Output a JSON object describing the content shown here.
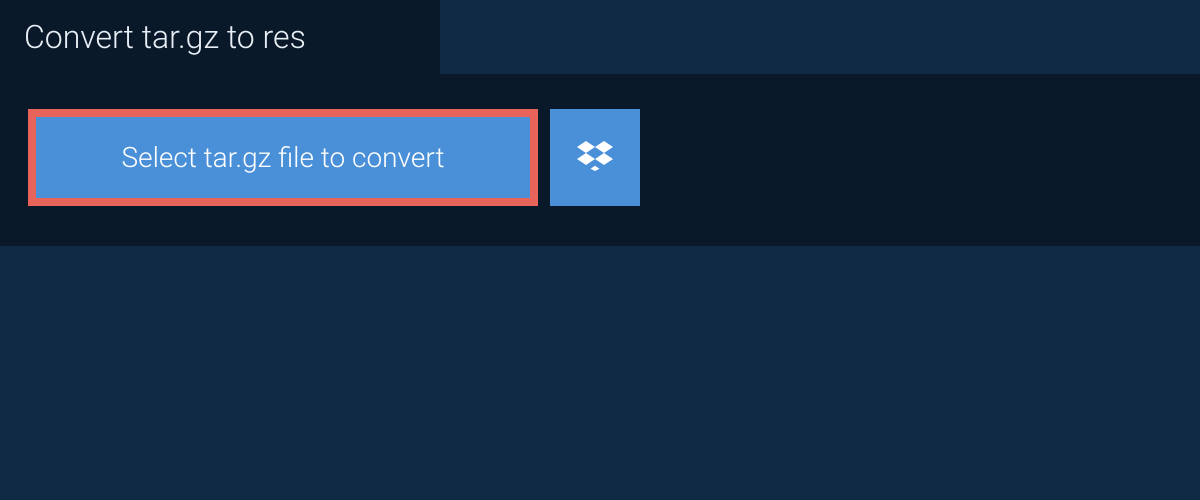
{
  "header": {
    "title": "Convert tar.gz to res"
  },
  "main": {
    "select_button_label": "Select tar.gz file to convert"
  },
  "colors": {
    "background": "#102a43",
    "panel": "#0a1929",
    "button": "#4a90d9",
    "button_border": "#e8645a",
    "text_light": "#ffffff"
  }
}
